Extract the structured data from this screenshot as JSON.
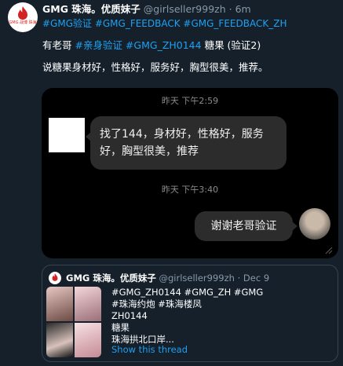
{
  "tweet": {
    "avatar_caption": "GMG 战博 珠海",
    "name": "GMG 珠海。优质妹子",
    "handle": "@girlseller999zh",
    "separator": "·",
    "time": "6m",
    "hashtags": "#GMG验证 #GMG_FEEDBACK #GMG_FEEDBACK_ZH",
    "line1_prefix": "有老哥 ",
    "line1_tags": "#亲身验证 #GMG_ZH0144",
    "line1_suffix": " 糖果 (验证2)",
    "line2": "说糖果身材好，性格好，服务好，胸型很美，推荐。"
  },
  "chat": {
    "timestamp1": "昨天 下午2:59",
    "incoming_line1": "找了144，身材好，性格好，服务",
    "incoming_line2": "好，胸型很美，推荐",
    "timestamp2": "昨天 下午3:40",
    "outgoing": "谢谢老哥验证"
  },
  "quote": {
    "name": "GMG 珠海。优质妹子",
    "handle": "@girlseller999zh",
    "separator": "·",
    "time": "Dec 9",
    "text_line1": "#GMG_ZH0144 #GMG_ZH #GMG",
    "text_line2": "#珠海约炮 #珠海楼凤",
    "text_line3": "ZH0144",
    "text_line4": "糖果",
    "text_line5": "珠海拱北口岸...",
    "show_thread": "Show this thread"
  },
  "colors": {
    "background": "#15202b",
    "link": "#1da1f2",
    "muted": "#8899a6",
    "brand_red": "#d22222"
  }
}
